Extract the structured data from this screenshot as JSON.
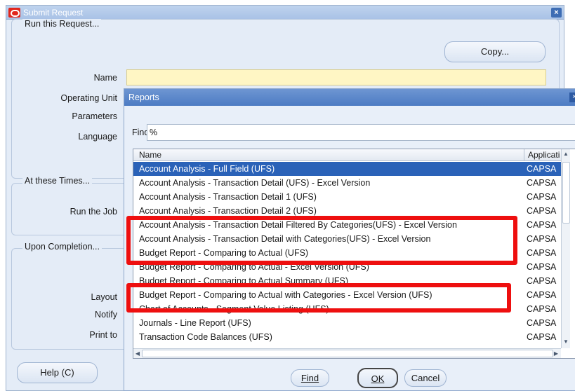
{
  "window": {
    "title": "Submit Request"
  },
  "run_group": {
    "title": "Run this Request...",
    "copy_button": "Copy...",
    "name_label": "Name",
    "operating_unit_label": "Operating Unit",
    "parameters_label": "Parameters",
    "language_label": "Language"
  },
  "times_group": {
    "title": "At these Times...",
    "run_job_label": "Run the Job"
  },
  "completion_group": {
    "title": "Upon Completion...",
    "layout_label": "Layout",
    "notify_label": "Notify",
    "print_to_label": "Print to"
  },
  "help_button": "Help (C)",
  "dialog": {
    "title": "Reports",
    "find_label": "Find",
    "find_value": "%",
    "columns": {
      "name": "Name",
      "application": "Applicati"
    },
    "rows": [
      {
        "name": "Account Analysis - Full Field (UFS)",
        "app": "CAPSA",
        "selected": true
      },
      {
        "name": "Account Analysis - Transaction Detail (UFS) - Excel Version",
        "app": "CAPSA"
      },
      {
        "name": "Account Analysis - Transaction Detail 1 (UFS)",
        "app": "CAPSA"
      },
      {
        "name": "Account Analysis - Transaction Detail 2 (UFS)",
        "app": "CAPSA"
      },
      {
        "name": "Account Analysis - Transaction Detail Filtered By Categories(UFS) - Excel Version",
        "app": "CAPSA"
      },
      {
        "name": "Account Analysis - Transaction Detail with Categories(UFS) - Excel Version",
        "app": "CAPSA"
      },
      {
        "name": "Budget Report - Comparing to Actual (UFS)",
        "app": "CAPSA"
      },
      {
        "name": "Budget Report - Comparing to Actual - Excel Version (UFS)",
        "app": "CAPSA"
      },
      {
        "name": "Budget Report - Comparing to Actual Summary (UFS)",
        "app": "CAPSA"
      },
      {
        "name": "Budget Report - Comparing to Actual with Categories - Excel Version (UFS)",
        "app": "CAPSA"
      },
      {
        "name": "Chart of Accounts - Segment Value Listing (UFS)",
        "app": "CAPSA"
      },
      {
        "name": "Journals - Line Report (UFS)",
        "app": "CAPSA"
      },
      {
        "name": "Transaction Code Balances (UFS)",
        "app": "CAPSA"
      }
    ],
    "buttons": {
      "find": "Find",
      "ok": "OK",
      "cancel": "Cancel"
    }
  },
  "colors": {
    "selection": "#2a62b8",
    "highlight_box": "#ee0f0f",
    "name_field": "#fff6c4"
  }
}
